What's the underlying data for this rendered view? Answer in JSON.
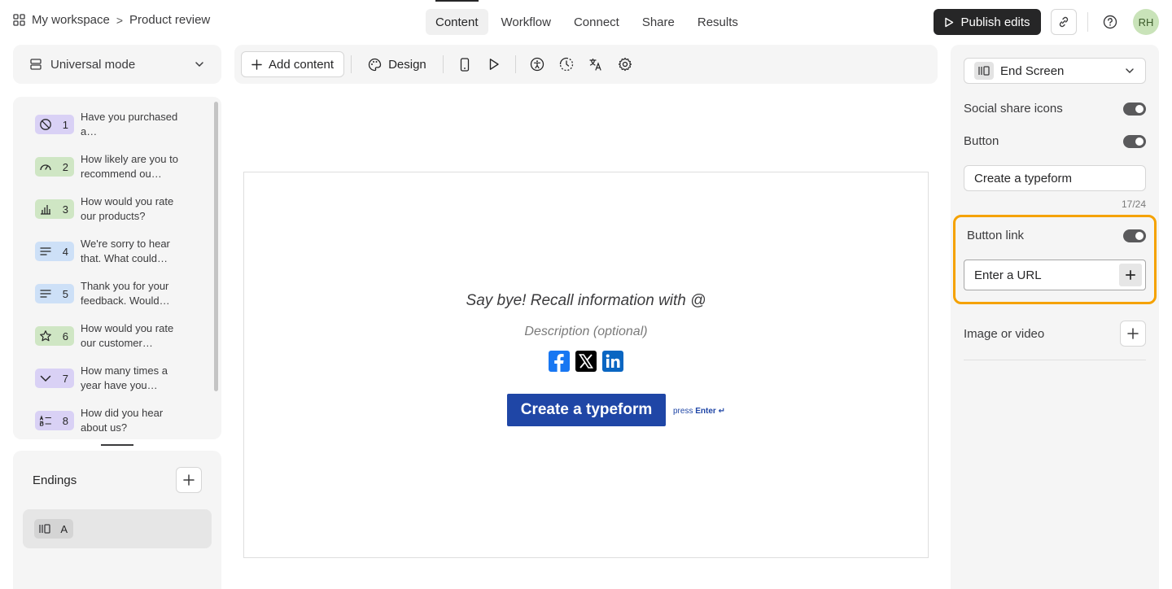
{
  "breadcrumb": {
    "workspace": "My workspace",
    "separator": ">",
    "form": "Product review"
  },
  "tabs": [
    {
      "label": "Content",
      "active": true
    },
    {
      "label": "Workflow"
    },
    {
      "label": "Connect"
    },
    {
      "label": "Share"
    },
    {
      "label": "Results"
    }
  ],
  "header": {
    "publish_label": "Publish edits",
    "avatar_initials": "RH"
  },
  "mode_select": {
    "label": "Universal mode"
  },
  "toolbar": {
    "add_content_label": "Add content",
    "design_label": "Design"
  },
  "questions": [
    {
      "number": "1",
      "text": "Have you purchased a…",
      "color": "#d9d1f5",
      "icon": "no-entry-icon"
    },
    {
      "number": "2",
      "text": "How likely are you to recommend ou…",
      "color": "#cfe6c4",
      "icon": "gauge-icon"
    },
    {
      "number": "3",
      "text": "How would you rate our products?",
      "color": "#cfe6c4",
      "icon": "bar-chart-icon"
    },
    {
      "number": "4",
      "text": "We're sorry to hear that. What could…",
      "color": "#cde0f7",
      "icon": "long-text-icon"
    },
    {
      "number": "5",
      "text": "Thank you for your feedback. Would…",
      "color": "#cde0f7",
      "icon": "long-text-icon"
    },
    {
      "number": "6",
      "text": "How would you rate our customer…",
      "color": "#cfe6c4",
      "icon": "star-icon"
    },
    {
      "number": "7",
      "text": "How many times a year have you…",
      "color": "#d9d1f5",
      "icon": "dropdown-icon"
    },
    {
      "number": "8",
      "text": "How did you hear about us?",
      "color": "#d9d1f5",
      "icon": "ranking-icon"
    }
  ],
  "endings": {
    "title": "Endings",
    "items": [
      {
        "letter": "A"
      }
    ]
  },
  "canvas": {
    "headline": "Say bye! Recall information with @",
    "description": "Description (optional)",
    "cta_label": "Create a typeform",
    "press_text": "press",
    "press_key": "Enter ↵"
  },
  "right_panel": {
    "screen_type": "End Screen",
    "social_share_label": "Social share icons",
    "social_share_on": true,
    "button_label": "Button",
    "button_on": true,
    "button_text_value": "Create a typeform",
    "char_counter": "17/24",
    "button_link_label": "Button link",
    "button_link_on": true,
    "url_placeholder": "Enter a URL",
    "image_video_label": "Image or video"
  },
  "colors": {
    "accent": "#1f46a6",
    "highlight": "#f5a200",
    "dark": "#262627"
  }
}
